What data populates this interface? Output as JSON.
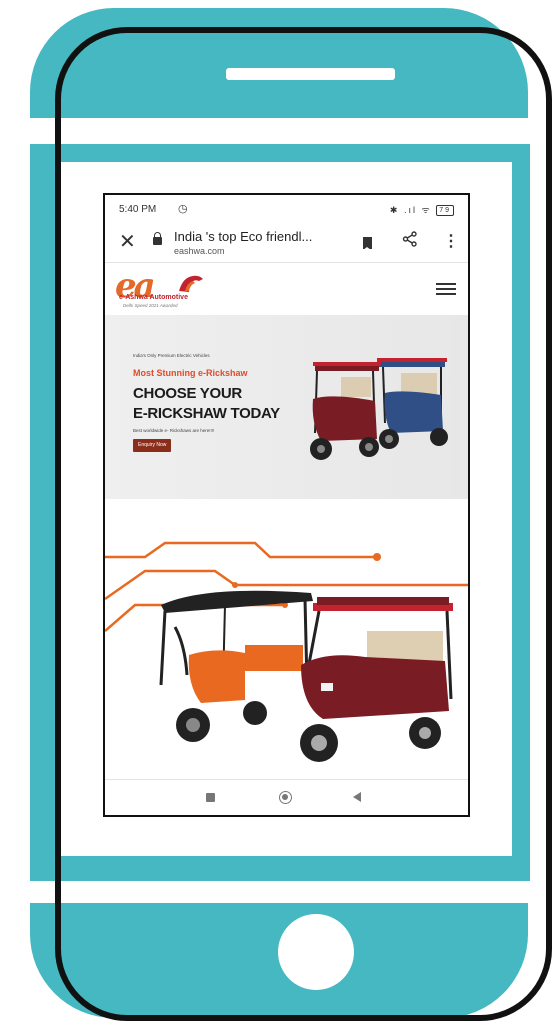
{
  "status_bar": {
    "time": "5:40 PM",
    "alarm_icon": "alarm-clock-icon",
    "signal_text": "✱ .ıl ᯤ",
    "battery": "79"
  },
  "browser": {
    "page_title": "India 's top Eco friendl...",
    "domain": "eashwa.com",
    "icons": [
      "close-icon",
      "lock-icon",
      "bookmark-icon",
      "share-icon",
      "more-vert-icon"
    ]
  },
  "site": {
    "logo_mark": "ea",
    "logo_name": "e-Ashwa Automotive",
    "logo_tagline": "Delhi Speed 2021 Awarded",
    "hero": {
      "eyebrow": "India's Only Premium Electric Vehicles",
      "subheading": "Most Stunning e-Rickshaw",
      "title_line1": "CHOOSE YOUR",
      "title_line2": "E-RICKSHAW TODAY",
      "description": "Best worldwide e- Rickshaws are here!!!!",
      "cta_label": "Enquiry Now"
    }
  },
  "colors": {
    "frame_teal": "#45b8c1",
    "brand_orange": "#e46a2a",
    "brand_red": "#c3232e",
    "cta_bg": "#8b2d1b",
    "rickshaw_maroon": "#7a1c24",
    "rickshaw_blue": "#2f4f86",
    "rickshaw_orange": "#e8691f"
  },
  "nav_bar": {
    "icons": [
      "recents-square-icon",
      "home-circle-icon",
      "back-triangle-icon"
    ]
  }
}
